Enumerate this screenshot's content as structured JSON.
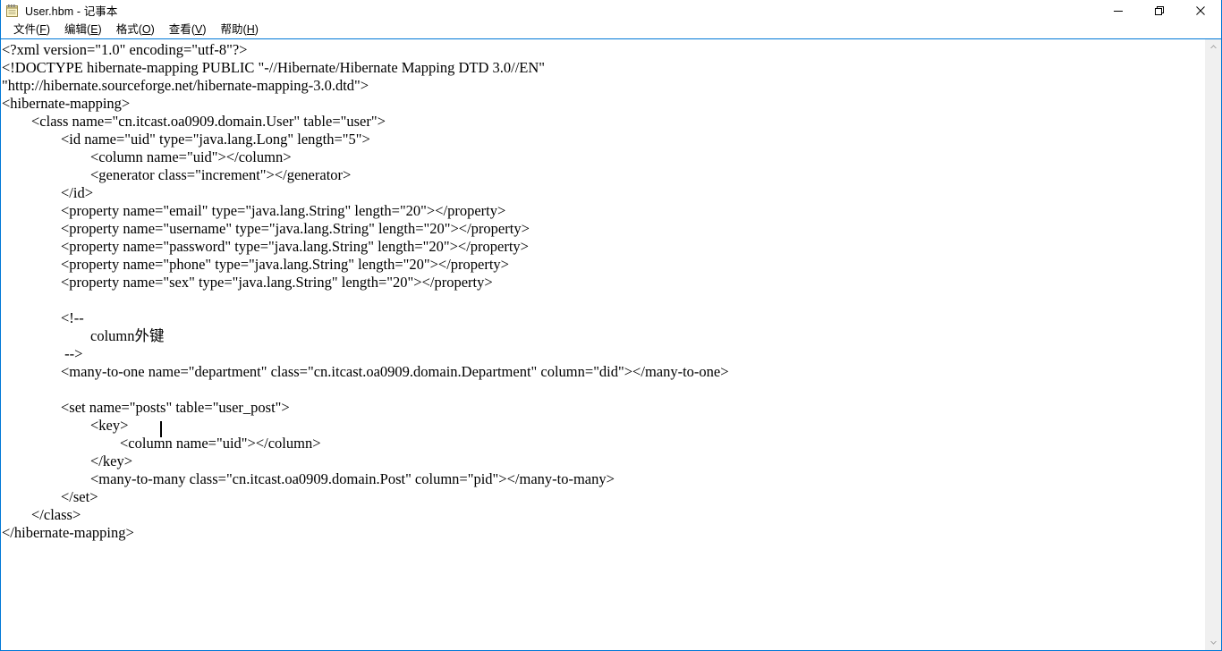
{
  "window": {
    "title": "User.hbm - 记事本",
    "icon": "notepad-icon",
    "accent_color": "#0078d7",
    "background_color": "#ffffff",
    "text_color": "#000000"
  },
  "titlebar": {
    "minimize_label": "—",
    "restore_label": "restore",
    "close_label": "✕"
  },
  "menubar": {
    "items": [
      {
        "label": "文件",
        "accel": "F"
      },
      {
        "label": "编辑",
        "accel": "E"
      },
      {
        "label": "格式",
        "accel": "O"
      },
      {
        "label": "查看",
        "accel": "V"
      },
      {
        "label": "帮助",
        "accel": "H"
      }
    ]
  },
  "editor": {
    "filename": "User.hbm",
    "caret_line": 22,
    "content": "<?xml version=\"1.0\" encoding=\"utf-8\"?>\n<!DOCTYPE hibernate-mapping PUBLIC \"-//Hibernate/Hibernate Mapping DTD 3.0//EN\"\n\"http://hibernate.sourceforge.net/hibernate-mapping-3.0.dtd\">\n<hibernate-mapping>\n\t<class name=\"cn.itcast.oa0909.domain.User\" table=\"user\">\n\t\t<id name=\"uid\" type=\"java.lang.Long\" length=\"5\">\n\t\t\t<column name=\"uid\"></column>\n\t\t\t<generator class=\"increment\"></generator>\n\t\t</id>\n\t\t<property name=\"email\" type=\"java.lang.String\" length=\"20\"></property>\n\t\t<property name=\"username\" type=\"java.lang.String\" length=\"20\"></property>\n\t\t<property name=\"password\" type=\"java.lang.String\" length=\"20\"></property>\n\t\t<property name=\"phone\" type=\"java.lang.String\" length=\"20\"></property>\n\t\t<property name=\"sex\" type=\"java.lang.String\" length=\"20\"></property>\n\n\t\t<!--\n\t\t\tcolumn外键\n\t\t -->\n\t\t<many-to-one name=\"department\" class=\"cn.itcast.oa0909.domain.Department\" column=\"did\"></many-to-one>\n\n\t\t<set name=\"posts\" table=\"user_post\">\n\t\t\t<key>\n\t\t\t\t<column name=\"uid\"></column>\n\t\t\t</key>\n\t\t\t<many-to-many class=\"cn.itcast.oa0909.domain.Post\" column=\"pid\"></many-to-many>\n\t\t</set>\n\t</class>\n</hibernate-mapping>"
  },
  "scrollbar": {
    "up_arrow": "▲",
    "down_arrow": "▼",
    "orientation": "vertical"
  }
}
